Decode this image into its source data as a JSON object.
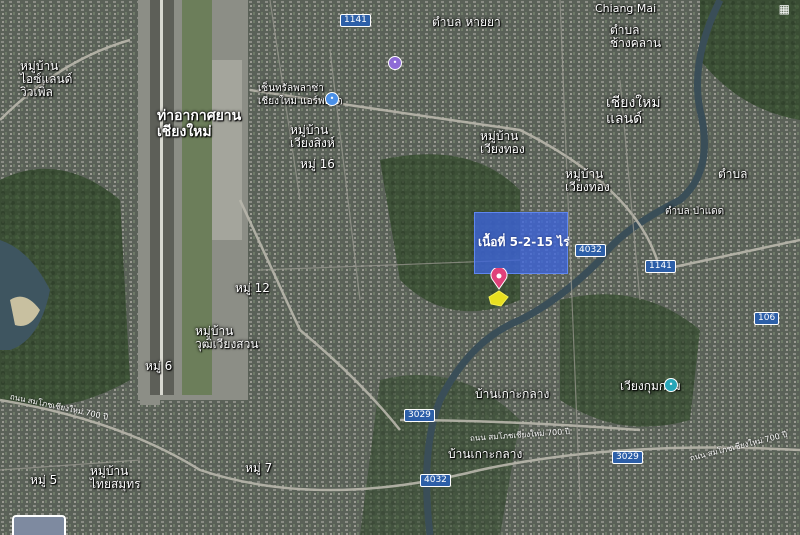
{
  "map": {
    "type": "satellite",
    "labels": {
      "airport": "ท่าอากาศยาน\nเชียงใหม่",
      "moo6_top": "หมู่บ้าน\nไอซ์แลนด์\nวิวเพิ่ล",
      "central": "เซ็นทรัลพลาซ่า\nเชียงใหม่ แอร์พอร์ต",
      "moo_village1": "หมู่บ้าน\nเวียงสิงห์",
      "moo16": "หมู่ 16",
      "moo12": "หมู่ 12",
      "moo_village2": "หมู่บ้าน\nวุฒิเวียงสวน",
      "moo6": "หมู่ 6",
      "moo5": "หมู่ 5",
      "moo_village3": "หมู่บ้าน\nไทยสมุทร",
      "moo7": "หมู่ 7",
      "ban_koklang1": "บ้านเกาะกลาง",
      "ban_koklang2": "บ้านเกาะกลาง",
      "moo_village4": "หมู่บ้าน\nเวียงทอง",
      "moo_village5": "หมู่บ้าน\nเวียงทอง",
      "chiangmai_land": "เชียงใหม่\nแลนด์",
      "tambon_haiya": "ตำบล หายยา",
      "tambon_changklan": "ตำบล\nช้างคลาน",
      "chiang_mai": "Chiang Mai",
      "wiang_kum_kam": "เวียงกุมกาม",
      "tambon_top_right": "ตำบล",
      "pa_daet": "ตำบล ป่าแดด"
    },
    "shields": [
      "1141",
      "4032",
      "1141",
      "3029",
      "3029",
      "4032",
      "106"
    ],
    "road_names": {
      "r1": "ถนน สมโภชเชียงใหม่ 700 ปี",
      "r2": "ถนน สมโภชเชียงใหม่ 700 ปี",
      "r3": "ถนน สมโภชเชียงใหม่ 700 ปี"
    },
    "marked_area_label": "เนื้อที่ 5-2-15 ไร่",
    "accent_colors": {
      "area_fill": "#3c64dc",
      "pin": "#e0407a",
      "parcel": "#e8e020"
    },
    "icons": [
      "grid-menu-icon",
      "location-pin-icon"
    ]
  }
}
